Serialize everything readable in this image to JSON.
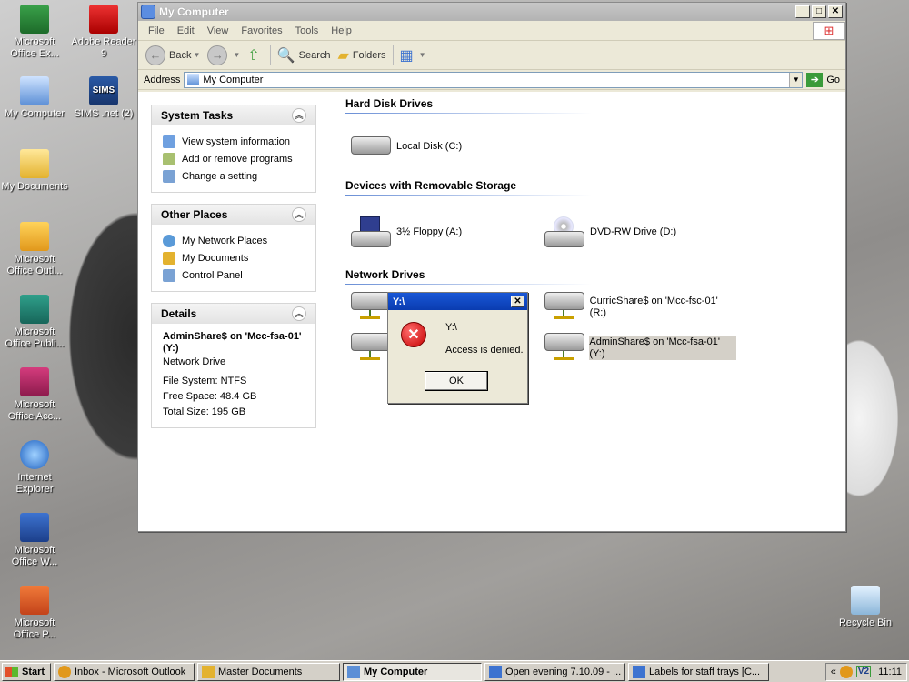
{
  "desktop": {
    "icons": [
      {
        "label": "Microsoft Office Ex..."
      },
      {
        "label": "Adobe Reader 9"
      },
      {
        "label": "My Computer"
      },
      {
        "label": "SIMS .net (2)"
      },
      {
        "label": "My Documents"
      },
      {
        "label": "Microsoft Office Outl..."
      },
      {
        "label": "Microsoft Office Publi..."
      },
      {
        "label": "Microsoft Office Acc..."
      },
      {
        "label": "Internet Explorer"
      },
      {
        "label": "Microsoft Office W..."
      },
      {
        "label": "Microsoft Office P..."
      },
      {
        "label": "Recycle Bin"
      }
    ],
    "sims_icon_text": "SIMS"
  },
  "window": {
    "title": "My Computer",
    "menu": [
      "File",
      "Edit",
      "View",
      "Favorites",
      "Tools",
      "Help"
    ],
    "toolbar": {
      "back": "Back",
      "search": "Search",
      "folders": "Folders"
    },
    "address_label": "Address",
    "address_value": "My Computer",
    "go_label": "Go"
  },
  "left_pane": {
    "system_tasks": {
      "title": "System Tasks",
      "items": [
        "View system information",
        "Add or remove programs",
        "Change a setting"
      ]
    },
    "other_places": {
      "title": "Other Places",
      "items": [
        "My Network Places",
        "My Documents",
        "Control Panel"
      ]
    },
    "details": {
      "title": "Details",
      "name": "AdminShare$ on 'Mcc-fsa-01' (Y:)",
      "type": "Network Drive",
      "file_system": "File System: NTFS",
      "free_space": "Free Space: 48.4 GB",
      "total_size": "Total Size: 195 GB"
    }
  },
  "content": {
    "hard_disk_title": "Hard Disk Drives",
    "hard_disks": [
      "Local Disk (C:)"
    ],
    "removable_title": "Devices with Removable Storage",
    "removable": [
      "3½ Floppy (A:)",
      "DVD-RW Drive (D:)"
    ],
    "network_title": "Network Drives",
    "network": [
      "CurricShare$ on 'Mcc-fsc-01' (R:)",
      "AdminShare$ on 'Mcc-fsa-01' (Y:)"
    ]
  },
  "dialog": {
    "title": "Y:\\",
    "path": "Y:\\",
    "message": "Access is denied.",
    "ok": "OK"
  },
  "taskbar": {
    "start": "Start",
    "tasks": [
      {
        "label": "Inbox - Microsoft Outlook"
      },
      {
        "label": "Master Documents"
      },
      {
        "label": "My Computer"
      },
      {
        "label": "Open evening 7.10.09 - ..."
      },
      {
        "label": "Labels for staff trays [C..."
      }
    ],
    "tray_text": "V2",
    "clock": "11:11"
  }
}
